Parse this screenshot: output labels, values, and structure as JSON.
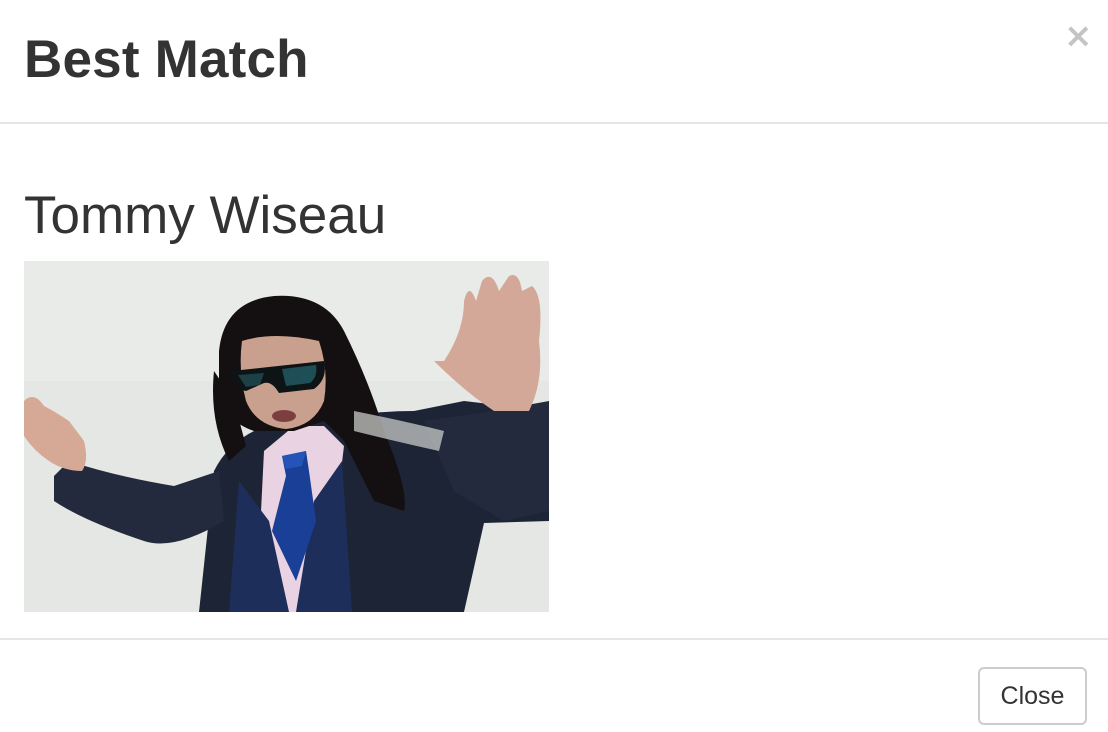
{
  "modal": {
    "title": "Best Match",
    "close_icon": "close-icon",
    "close_glyph": "×"
  },
  "result": {
    "name": "Tommy Wiseau",
    "photo_icon": "person-photo"
  },
  "footer": {
    "close_label": "Close"
  },
  "colors": {
    "text": "#333333",
    "divider": "#e5e5e5",
    "close_x": "#c4c4c4",
    "button_border": "#cccccc"
  }
}
